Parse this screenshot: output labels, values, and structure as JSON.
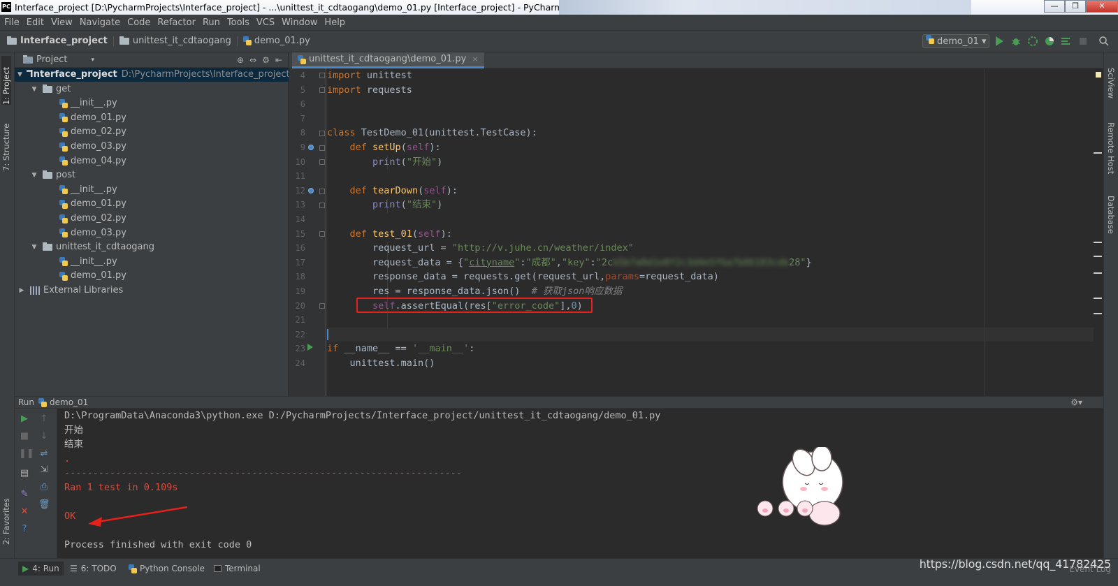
{
  "window": {
    "title": "Interface_project [D:\\PycharmProjects\\Interface_project] - ...\\unittest_it_cdtaogang\\demo_01.py [Interface_project] - PyCharm",
    "app_badge": "PC",
    "controls": {
      "minimize": "—",
      "maximize": "❐",
      "close": "✕"
    }
  },
  "menu": [
    "File",
    "Edit",
    "View",
    "Navigate",
    "Code",
    "Refactor",
    "Run",
    "Tools",
    "VCS",
    "Window",
    "Help"
  ],
  "breadcrumb": [
    "Interface_project",
    "unittest_it_cdtaogang",
    "demo_01.py"
  ],
  "run_config": "demo_01 ▾",
  "left_tabs": {
    "project": "1: Project",
    "structure": "7: Structure",
    "favorites": "2: Favorites"
  },
  "right_tabs": {
    "sciview": "SciView",
    "remote": "Remote Host",
    "database": "Database"
  },
  "project_panel": {
    "title": "Project",
    "dropdown": "▾",
    "root": {
      "name": "Interface_project",
      "path": "D:\\PycharmProjects\\Interface_project"
    },
    "folders": [
      {
        "name": "get",
        "files": [
          "__init__.py",
          "demo_01.py",
          "demo_02.py",
          "demo_03.py",
          "demo_04.py"
        ]
      },
      {
        "name": "post",
        "files": [
          "__init__.py",
          "demo_01.py",
          "demo_02.py",
          "demo_03.py"
        ]
      },
      {
        "name": "unittest_it_cdtaogang",
        "files": [
          "__init__.py",
          "demo_01.py"
        ]
      }
    ],
    "external": "External Libraries"
  },
  "editor": {
    "tab": "unittest_it_cdtaogang\\demo_01.py",
    "tab_close": "×",
    "line_numbers": [
      "4",
      "5",
      "6",
      "7",
      "8",
      "9",
      "10",
      "11",
      "12",
      "13",
      "14",
      "15",
      "16",
      "17",
      "18",
      "19",
      "20",
      "21",
      "22",
      "23",
      "24"
    ]
  },
  "run_panel": {
    "label": "Run",
    "config": "demo_01",
    "output": [
      "D:\\ProgramData\\Anaconda3\\python.exe D:/PycharmProjects/Interface_project/unittest_it_cdtaogang/demo_01.py",
      "开始",
      "结束",
      ".",
      "----------------------------------------------------------------------",
      "Ran 1 test in 0.109s",
      "",
      "OK",
      "",
      "Process finished with exit code 0"
    ]
  },
  "bottom_tabs": [
    "4: Run",
    "6: TODO",
    "Python Console",
    "Terminal"
  ],
  "status": {
    "event_log": "Event Log",
    "watermark": "https://blog.csdn.net/qq_41782425"
  },
  "colors": {
    "keyword": "#cc7832",
    "string": "#6a8759",
    "function": "#ffc66d",
    "self": "#94558d",
    "comment": "#808080",
    "error_red": "#e8201a",
    "accent": "#4a88c7"
  }
}
